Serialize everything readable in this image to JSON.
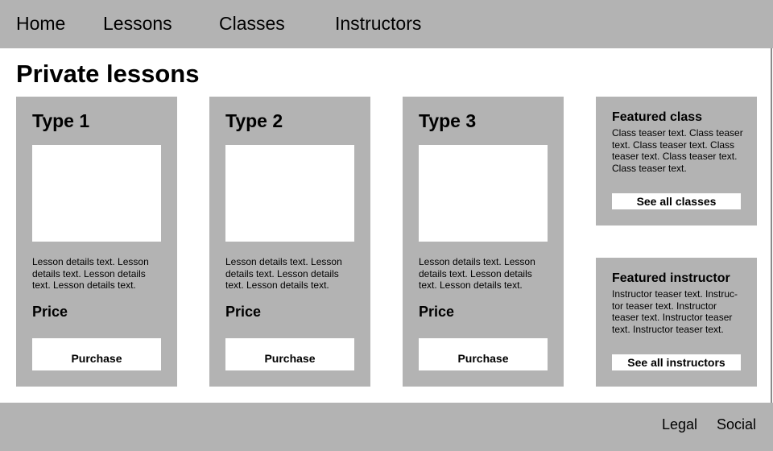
{
  "nav": {
    "items": [
      {
        "label": "Home"
      },
      {
        "label": "Lessons"
      },
      {
        "label": "Classes"
      },
      {
        "label": "Instructors"
      }
    ]
  },
  "page": {
    "title": "Private lessons"
  },
  "lessons": [
    {
      "title": "Type 1",
      "details": "Lesson details text. Lesson details text. Lesson details text. Lesson details text.",
      "price": "Price",
      "button": "Purchase"
    },
    {
      "title": "Type 2",
      "details": "Lesson details text. Lesson details text. Lesson details text. Lesson details text.",
      "price": "Price",
      "button": "Purchase"
    },
    {
      "title": "Type 3",
      "details": "Lesson details text. Lesson details text. Lesson details text. Lesson details text.",
      "price": "Price",
      "button": "Purchase"
    }
  ],
  "featured_class": {
    "title": "Featured class",
    "text": "Class teaser text. Class teaser text. Class teaser text. Class teaser text. Class teaser text. Class teaser text.",
    "button": "See all classes"
  },
  "featured_instructor": {
    "title": "Featured instructor",
    "text": "Instructor teaser text. Instruc-tor teaser text. Instructor teaser text. Instructor teaser text. Instructor teaser text.",
    "button": "See all instructors"
  },
  "footer": {
    "links": [
      {
        "label": "Legal"
      },
      {
        "label": "Social"
      }
    ]
  },
  "colors": {
    "panel": "#b3b3b3",
    "background": "#ffffff",
    "text": "#000000"
  }
}
